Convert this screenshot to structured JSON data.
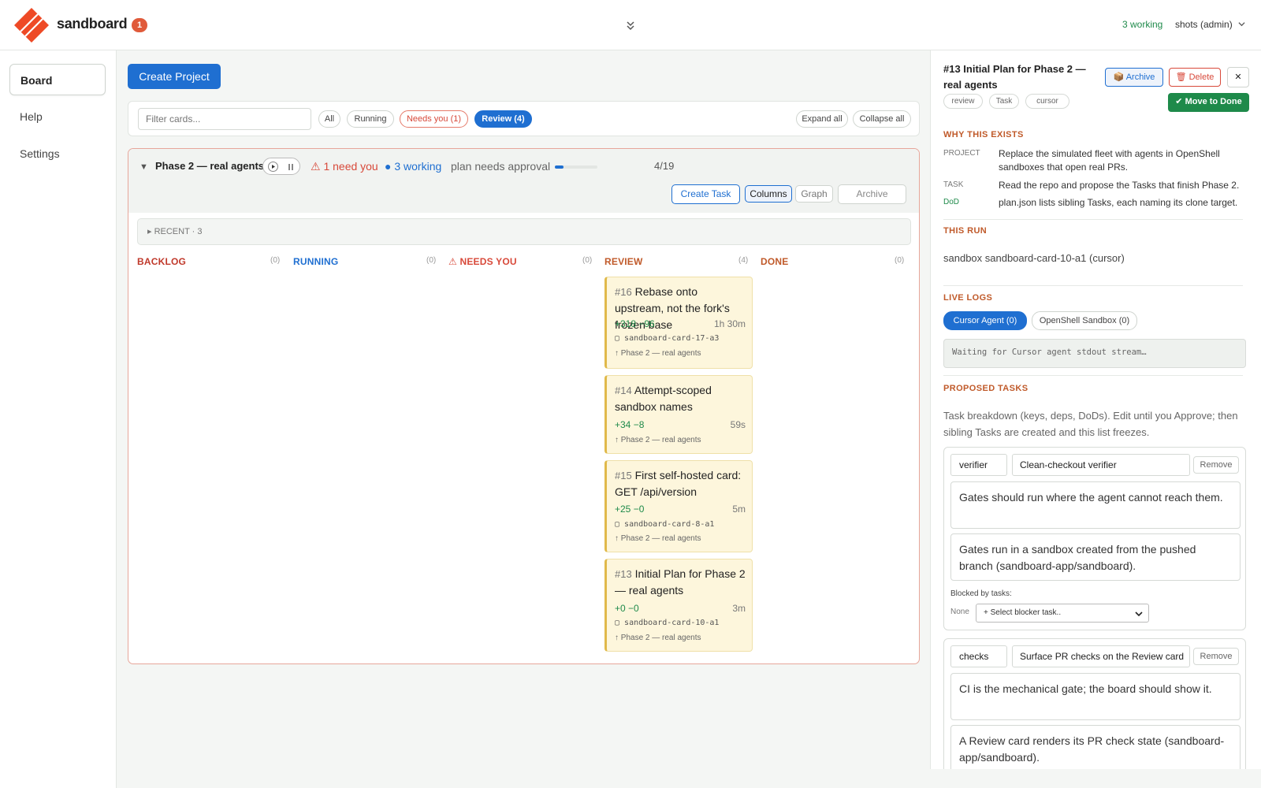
{
  "app": {
    "brand": "sandboard",
    "notif_count": "1",
    "working": "3 working",
    "user": "shots (admin)"
  },
  "sidebar": {
    "items": [
      "Board",
      "Help",
      "Settings"
    ]
  },
  "toolbar": {
    "create_project": "Create Project",
    "filter_placeholder": "Filter cards...",
    "pills": [
      "All",
      "Running",
      "Needs you (1)",
      "Review (4)"
    ],
    "expand_all": "Expand all",
    "collapse_all": "Collapse all"
  },
  "project": {
    "title": "Phase 2 — real agents",
    "need_you": "⚠ 1 need you",
    "working": "● 3 working",
    "plan_status": "plan needs approval",
    "progress_done": 4,
    "progress_total": 19,
    "progress_text": "4/19",
    "buttons": {
      "create_task": "Create Task",
      "columns": "Columns",
      "graph": "Graph",
      "archive": "Archive"
    },
    "recent": "▸ RECENT · 3",
    "columns": [
      {
        "name": "BACKLOG",
        "count": "(0)",
        "color": "#c0392b"
      },
      {
        "name": "RUNNING",
        "count": "(0)",
        "color": "#1f6fd1"
      },
      {
        "name": "⚠ NEEDS YOU",
        "count": "(0)",
        "color": "#d8493a"
      },
      {
        "name": "REVIEW",
        "count": "(4)",
        "color": "#c05a2a"
      },
      {
        "name": "DONE",
        "count": "(0)",
        "color": "#c05a2a"
      }
    ],
    "cards": [
      {
        "num": "#16",
        "title": "Rebase onto upstream, not the fork's frozen base",
        "diff": "+318 −96",
        "time": "1h 30m",
        "sandbox": "sandboard-card-17-a3",
        "parent": "↑ Phase 2 — real agents"
      },
      {
        "num": "#14",
        "title": "Attempt-scoped sandbox names",
        "diff": "+34 −8",
        "time": "59s",
        "sandbox": "",
        "parent": "↑ Phase 2 — real agents"
      },
      {
        "num": "#15",
        "title": "First self-hosted card: GET /api/version",
        "diff": "+25 −0",
        "time": "5m",
        "sandbox": "sandboard-card-8-a1",
        "parent": "↑ Phase 2 — real agents"
      },
      {
        "num": "#13",
        "title": "Initial Plan for Phase 2 — real agents",
        "diff": "+0 −0",
        "time": "3m",
        "sandbox": "sandboard-card-10-a1",
        "parent": "↑ Phase 2 — real agents"
      }
    ]
  },
  "panel": {
    "title": "#13 Initial Plan for Phase 2 — real agents",
    "tags": [
      "review",
      "Task",
      "cursor"
    ],
    "archive": "📦 Archive",
    "delete": "🗑 Delete",
    "close": "✕",
    "move_done": "✔ Move to Done",
    "why_title": "WHY THIS EXISTS",
    "project_k": "PROJECT",
    "project_v": "Replace the simulated fleet with agents in OpenShell sandboxes that open real PRs.",
    "task_k": "TASK",
    "task_v": "Read the repo and propose the Tasks that finish Phase 2.",
    "dod_k": "DoD",
    "dod_v": "plan.json lists sibling Tasks, each naming its clone target.",
    "run_title": "THIS RUN",
    "run_v": "sandbox sandboard-card-10-a1 (cursor)",
    "logs_title": "LIVE LOGS",
    "logs_tab1": "Cursor Agent (0)",
    "logs_tab2": "OpenShell Sandbox (0)",
    "logs_text": "Waiting for Cursor agent stdout stream…",
    "proposed_title": "PROPOSED TASKS",
    "proposed_desc": "Task breakdown (keys, deps, DoDs). Edit until you Approve; then sibling Tasks are created and this list freezes.",
    "tasks": [
      {
        "key": "verifier",
        "name": "Clean-checkout verifier",
        "remove": "Remove",
        "why": "Gates should run where the agent cannot reach them.",
        "dod": "Gates run in a sandbox created from the pushed branch (sandboard-app/sandboard).",
        "blocked": "Blocked by tasks:",
        "none": "None",
        "select": "+ Select blocker task.."
      },
      {
        "key": "checks",
        "name": "Surface PR checks on the Review card",
        "remove": "Remove",
        "why": "CI is the mechanical gate; the board should show it.",
        "dod": "A Review card renders its PR check state (sandboard-app/sandboard)."
      }
    ]
  }
}
